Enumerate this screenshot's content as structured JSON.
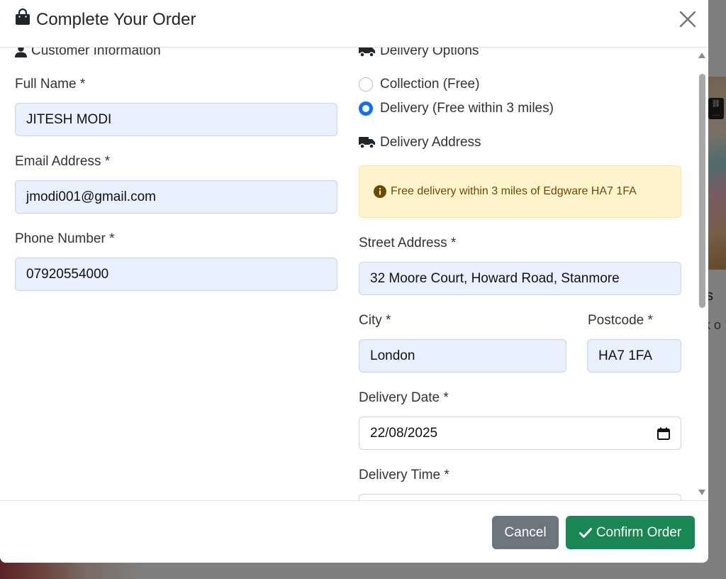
{
  "modal": {
    "title": "Complete Your Order",
    "title_icon": "shopping-bag-icon",
    "close_icon": "close-icon"
  },
  "customer": {
    "heading": "Customer Information",
    "full_name_label": "Full Name *",
    "full_name_value": "JITESH MODI",
    "email_label": "Email Address *",
    "email_value": "jmodi001@gmail.com",
    "phone_label": "Phone Number *",
    "phone_value": "07920554000"
  },
  "delivery": {
    "options_heading": "Delivery Options",
    "option_collection": "Collection (Free)",
    "option_delivery": "Delivery (Free within 3 miles)",
    "selected_option": "delivery",
    "address_heading": "Delivery Address",
    "alert_text": "Free delivery within 3 miles of Edgware HA7 1FA",
    "street_label": "Street Address *",
    "street_value": "32 Moore Court, Howard Road, Stanmore",
    "city_label": "City *",
    "city_value": "London",
    "postcode_label": "Postcode *",
    "postcode_value": "HA7 1FA",
    "date_label": "Delivery Date *",
    "date_value": "22/08/2025",
    "time_label": "Delivery Time *"
  },
  "footer": {
    "cancel_label": "Cancel",
    "confirm_label": "Confirm Order"
  },
  "background": {
    "partial_text_1": "s",
    "partial_text_2": "k o"
  },
  "colors": {
    "primary": "#0d6efd",
    "success": "#198754",
    "secondary": "#6c757d",
    "autofill": "#e8f0fe",
    "alert_bg": "#fff3cd"
  }
}
